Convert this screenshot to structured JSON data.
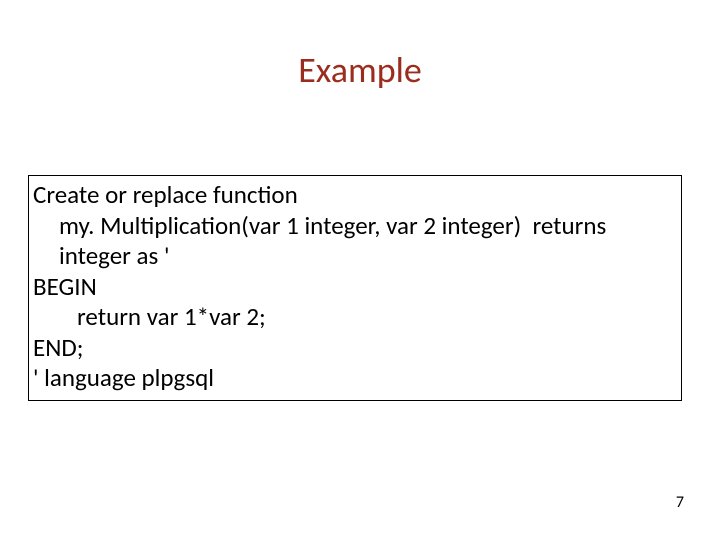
{
  "title": "Example",
  "code": {
    "l1": "Create or replace function",
    "l2": "my. Multiplication(var 1 integer, var 2 integer)  returns integer as '",
    "l3": "BEGIN",
    "l4": "return var 1*var 2;",
    "l5": "END;",
    "l6": "' language plpgsql"
  },
  "page_number": "7"
}
